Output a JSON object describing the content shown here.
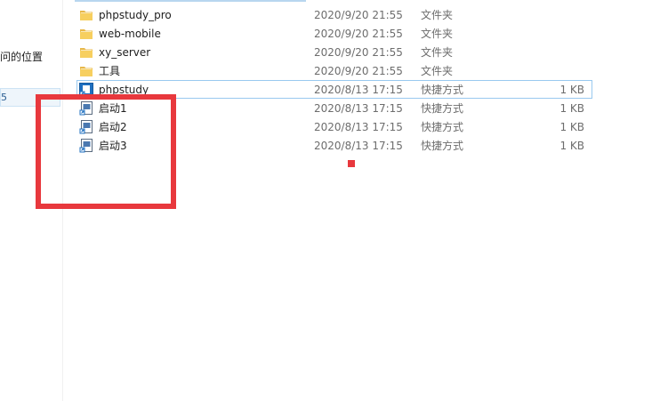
{
  "nav": {
    "partial_item_label": "问的位置",
    "selected_item_label": "5"
  },
  "colors": {
    "annotation_red": "#e8383d",
    "folder_yellow": "#f7cf5f",
    "shortcut_blue": "#1e6fc0",
    "selection_border": "#99c9ef"
  },
  "files": [
    {
      "name": "phpstudy_pro",
      "date": "2020/9/20 21:55",
      "type": "文件夹",
      "size": "",
      "icon": "folder-icon"
    },
    {
      "name": "web-mobile",
      "date": "2020/9/20 21:55",
      "type": "文件夹",
      "size": "",
      "icon": "folder-icon"
    },
    {
      "name": "xy_server",
      "date": "2020/9/20 21:55",
      "type": "文件夹",
      "size": "",
      "icon": "folder-icon"
    },
    {
      "name": "工具",
      "date": "2020/9/20 21:55",
      "type": "文件夹",
      "size": "",
      "icon": "folder-icon"
    },
    {
      "name": "phpstudy",
      "date": "2020/8/13 17:15",
      "type": "快捷方式",
      "size": "1 KB",
      "icon": "shortcut-app-icon"
    },
    {
      "name": "启动1",
      "date": "2020/8/13 17:15",
      "type": "快捷方式",
      "size": "1 KB",
      "icon": "shortcut-icon"
    },
    {
      "name": "启动2",
      "date": "2020/8/13 17:15",
      "type": "快捷方式",
      "size": "1 KB",
      "icon": "shortcut-icon"
    },
    {
      "name": "启动3",
      "date": "2020/8/13 17:15",
      "type": "快捷方式",
      "size": "1 KB",
      "icon": "shortcut-icon"
    }
  ]
}
